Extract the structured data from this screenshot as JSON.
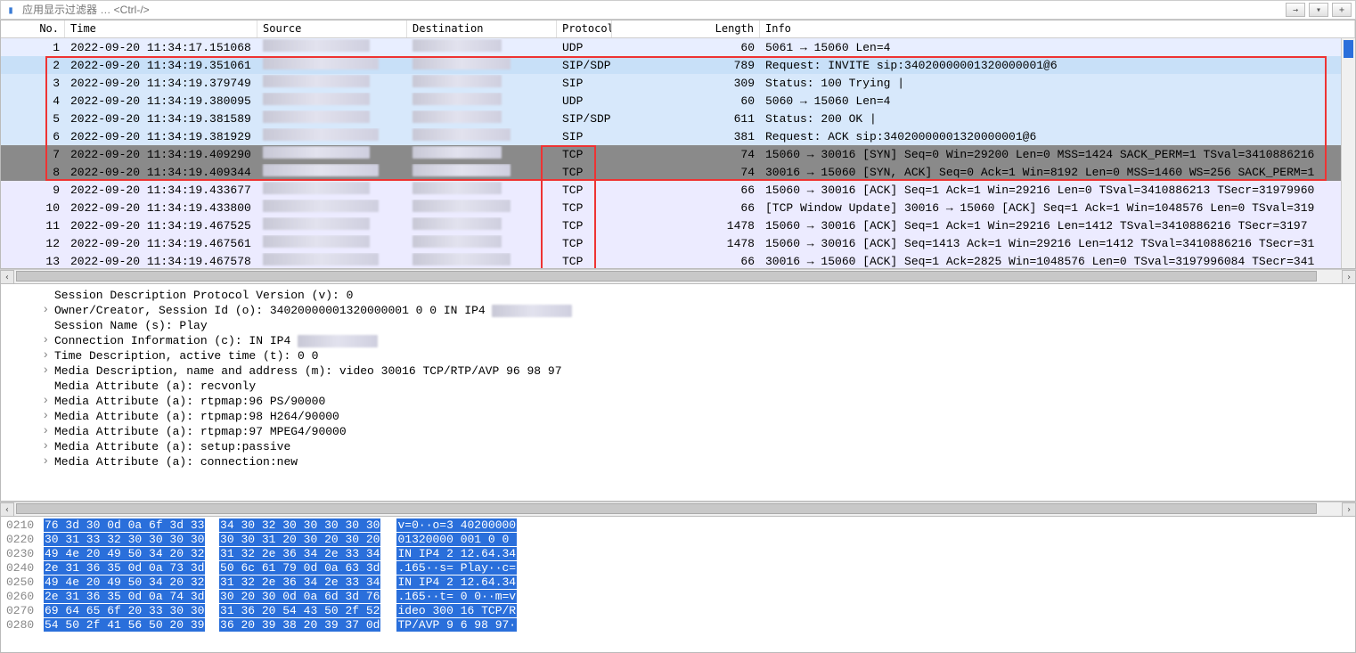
{
  "filter": {
    "placeholder": "应用显示过滤器 … <Ctrl-/>"
  },
  "columns": {
    "no": "No.",
    "time": "Time",
    "source": "Source",
    "destination": "Destination",
    "protocol": "Protocol",
    "length": "Length",
    "info": "Info"
  },
  "packets": [
    {
      "no": 1,
      "time": "2022-09-20 11:34:17.151068",
      "proto": "UDP",
      "len": 60,
      "info": "5061 → 15060 Len=4",
      "bg": "udp",
      "srcbl": 120,
      "dstbl": 100,
      "tail": "6"
    },
    {
      "no": 2,
      "time": "2022-09-20 11:34:19.351061",
      "proto": "SIP/SDP",
      "len": 789,
      "info": "Request: INVITE sip:34020000001320000001@6",
      "bg": "sel",
      "srcbl": 130,
      "dstbl": 110,
      "tail": "1"
    },
    {
      "no": 3,
      "time": "2022-09-20 11:34:19.379749",
      "proto": "SIP",
      "len": 309,
      "info": "Status: 100 Trying |",
      "bg": "sip",
      "srcbl": 120,
      "dstbl": 100,
      "tail": "6"
    },
    {
      "no": 4,
      "time": "2022-09-20 11:34:19.380095",
      "proto": "UDP",
      "len": 60,
      "info": "5060 → 15060 Len=4",
      "bg": "sip",
      "srcbl": 120,
      "dstbl": 100,
      "tail": "6"
    },
    {
      "no": 5,
      "time": "2022-09-20 11:34:19.381589",
      "proto": "SIP/SDP",
      "len": 611,
      "info": "Status: 200 OK |",
      "bg": "sip",
      "srcbl": 120,
      "dstbl": 100,
      "tail": "6"
    },
    {
      "no": 6,
      "time": "2022-09-20 11:34:19.381929",
      "proto": "SIP",
      "len": 381,
      "info": "Request: ACK sip:34020000001320000001@6",
      "bg": "sip",
      "srcbl": 130,
      "dstbl": 110,
      "tail": "1"
    },
    {
      "no": 7,
      "time": "2022-09-20 11:34:19.409290",
      "proto": "TCP",
      "len": 74,
      "info": "15060 → 30016 [SYN] Seq=0 Win=29200 Len=0 MSS=1424 SACK_PERM=1 TSval=3410886216",
      "bg": "tcpdark",
      "srcbl": 120,
      "dstbl": 100,
      "tail": "6"
    },
    {
      "no": 8,
      "time": "2022-09-20 11:34:19.409344",
      "proto": "TCP",
      "len": 74,
      "info": "30016 → 15060 [SYN, ACK] Seq=0 Ack=1 Win=8192 Len=0 MSS=1460 WS=256 SACK_PERM=1",
      "bg": "tcpdark",
      "srcbl": 130,
      "dstbl": 110,
      "tail": "1"
    },
    {
      "no": 9,
      "time": "2022-09-20 11:34:19.433677",
      "proto": "TCP",
      "len": 66,
      "info": "15060 → 30016 [ACK] Seq=1 Ack=1 Win=29216 Len=0 TSval=3410886213 TSecr=31979960",
      "bg": "tcplight",
      "srcbl": 120,
      "dstbl": 100,
      "tail": "6"
    },
    {
      "no": 10,
      "time": "2022-09-20 11:34:19.433800",
      "proto": "TCP",
      "len": 66,
      "info": "[TCP Window Update] 30016 → 15060 [ACK] Seq=1 Ack=1 Win=1048576 Len=0 TSval=319",
      "bg": "tcplight",
      "srcbl": 130,
      "dstbl": 110,
      "tail": "1"
    },
    {
      "no": 11,
      "time": "2022-09-20 11:34:19.467525",
      "proto": "TCP",
      "len": 1478,
      "info": "15060 → 30016 [ACK] Seq=1 Ack=1 Win=29216 Len=1412 TSval=3410886216 TSecr=3197",
      "bg": "tcplight",
      "srcbl": 120,
      "dstbl": 100,
      "tail": "6"
    },
    {
      "no": 12,
      "time": "2022-09-20 11:34:19.467561",
      "proto": "TCP",
      "len": 1478,
      "info": "15060 → 30016 [ACK] Seq=1413 Ack=1 Win=29216 Len=1412 TSval=3410886216 TSecr=31",
      "bg": "tcplight",
      "srcbl": 120,
      "dstbl": 100,
      "tail": "6"
    },
    {
      "no": 13,
      "time": "2022-09-20 11:34:19.467578",
      "proto": "TCP",
      "len": 66,
      "info": "30016 → 15060 [ACK] Seq=1 Ack=2825 Win=1048576 Len=0 TSval=3197996084 TSecr=341",
      "bg": "tcplight",
      "srcbl": 130,
      "dstbl": 110,
      "tail": "1"
    }
  ],
  "details": [
    {
      "exp": false,
      "text": "Session Description Protocol Version (v): 0"
    },
    {
      "exp": true,
      "text": "Owner/Creator, Session Id (o): 34020000001320000001 0 0 IN IP4 "
    },
    {
      "exp": false,
      "text": "Session Name (s): Play"
    },
    {
      "exp": true,
      "text": "Connection Information (c): IN IP4 "
    },
    {
      "exp": true,
      "text": "Time Description, active time (t): 0 0"
    },
    {
      "exp": true,
      "text": "Media Description, name and address (m): video 30016 TCP/RTP/AVP 96 98 97"
    },
    {
      "exp": false,
      "text": "Media Attribute (a): recvonly"
    },
    {
      "exp": true,
      "text": "Media Attribute (a): rtpmap:96 PS/90000"
    },
    {
      "exp": true,
      "text": "Media Attribute (a): rtpmap:98 H264/90000"
    },
    {
      "exp": true,
      "text": "Media Attribute (a): rtpmap:97 MPEG4/90000"
    },
    {
      "exp": true,
      "text": "Media Attribute (a): setup:passive"
    },
    {
      "exp": true,
      "text": "Media Attribute (a): connection:new"
    }
  ],
  "hex": [
    {
      "off": "0210",
      "h1": "76 3d 30 0d 0a 6f 3d 33",
      "h2": "34 30 32 30 30 30 30 30",
      "a": "v=0··o=3 40200000"
    },
    {
      "off": "0220",
      "h1": "30 31 33 32 30 30 30 30",
      "h2": "30 30 31 20 30 20 30 20",
      "a": "01320000 001 0 0 "
    },
    {
      "off": "0230",
      "h1": "49 4e 20 49 50 34 20 32",
      "h2": "31 32 2e 36 34 2e 33 34",
      "a": "IN IP4 2 12.64.34"
    },
    {
      "off": "0240",
      "h1": "2e 31 36 35 0d 0a 73 3d",
      "h2": "50 6c 61 79 0d 0a 63 3d",
      "a": ".165··s= Play··c="
    },
    {
      "off": "0250",
      "h1": "49 4e 20 49 50 34 20 32",
      "h2": "31 32 2e 36 34 2e 33 34",
      "a": "IN IP4 2 12.64.34"
    },
    {
      "off": "0260",
      "h1": "2e 31 36 35 0d 0a 74 3d",
      "h2": "30 20 30 0d 0a 6d 3d 76",
      "a": ".165··t= 0 0··m=v"
    },
    {
      "off": "0270",
      "h1": "69 64 65 6f 20 33 30 30",
      "h2": "31 36 20 54 43 50 2f 52",
      "a": "ideo 300 16 TCP/R"
    },
    {
      "off": "0280",
      "h1": "54 50 2f 41 56 50 20 39",
      "h2": "36 20 39 38 20 39 37 0d",
      "a": "TP/AVP 9 6 98 97·"
    }
  ]
}
